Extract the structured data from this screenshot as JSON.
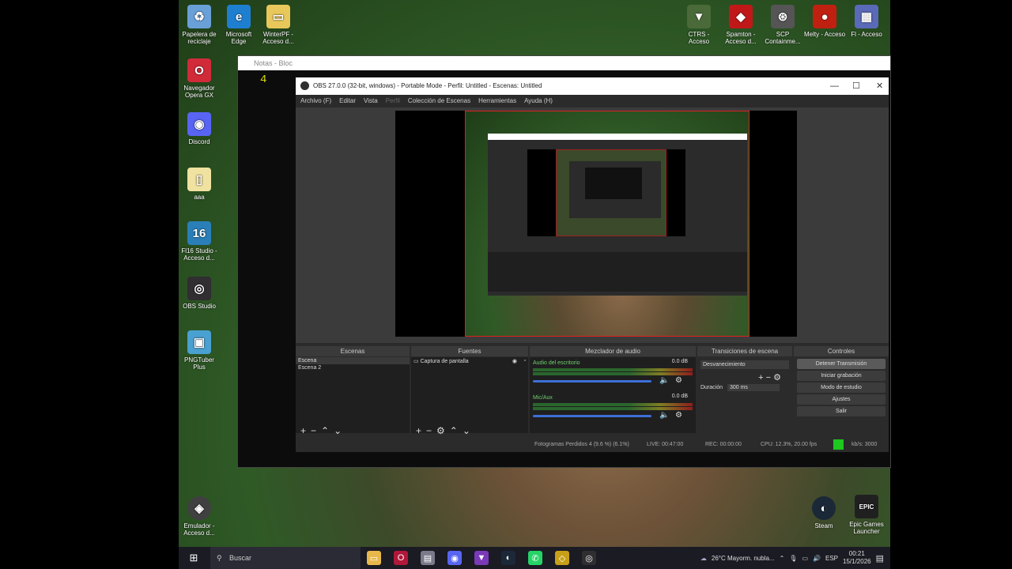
{
  "desktop": {
    "left_icons": [
      {
        "label": "Papelera de reciclaje",
        "icon": "recycle-bin-icon",
        "color": "#6aa0d8",
        "glyph": "♻"
      },
      {
        "label": "Microsoft Edge",
        "icon": "edge-icon",
        "color": "#1e7fd1",
        "glyph": "e"
      },
      {
        "label": "WinterPF - Acceso d...",
        "icon": "folder-icon",
        "color": "#e8c85a",
        "glyph": "▭"
      },
      {
        "label": "Navegador Opera GX",
        "icon": "opera-gx-icon",
        "color": "#d12b3a",
        "glyph": "O"
      },
      {
        "label": "Discord",
        "icon": "discord-icon",
        "color": "#5865f2",
        "glyph": "◉"
      },
      {
        "label": "aaa",
        "icon": "file-icon",
        "color": "#f0e2a0",
        "glyph": "▯"
      },
      {
        "label": "Fl16 Studio - Acceso d...",
        "icon": "fl-studio-icon",
        "color": "#2a7fb8",
        "glyph": "16"
      },
      {
        "label": "OBS Studio",
        "icon": "obs-icon",
        "color": "#302e31",
        "glyph": "◎"
      },
      {
        "label": "PNGTuber Plus",
        "icon": "pngtuber-icon",
        "color": "#4aa0d0",
        "glyph": "▣"
      }
    ],
    "right_icons": [
      {
        "label": "CTRS - Acceso",
        "icon": "ctrs-icon",
        "color": "#4a6a3a",
        "glyph": "▼"
      },
      {
        "label": "Spamton - Acceso d...",
        "icon": "spamton-icon",
        "color": "#c01818",
        "glyph": "◆"
      },
      {
        "label": "SCP Containme...",
        "icon": "scp-icon",
        "color": "#555555",
        "glyph": "⊛"
      },
      {
        "label": "Melty - Acceso",
        "icon": "melty-icon",
        "color": "#c02010",
        "glyph": "●"
      },
      {
        "label": "Fl - Acceso",
        "icon": "file-icon",
        "color": "#5a6ab8",
        "glyph": "▦"
      }
    ],
    "bottom_left_icon": {
      "label": "Emulador - Acceso d...",
      "icon": "emulator-icon",
      "color": "#404040",
      "glyph": "◈"
    },
    "bottom_right_icons": [
      {
        "label": "Steam",
        "icon": "steam-icon",
        "color": "#1b2838",
        "glyph": "◐"
      },
      {
        "label": "Epic Games Launcher",
        "icon": "epic-games-icon",
        "color": "#202020",
        "glyph": "EPIC"
      }
    ]
  },
  "console": {
    "title": "Notas - Bloc",
    "cursor": "4"
  },
  "obs": {
    "title": "OBS 27.0.0 (32-bit, windows) - Portable Mode - Perfil: Untitled - Escenas: Untitled",
    "menu": [
      "Archivo (F)",
      "Editar",
      "Vista",
      "Perfil",
      "Colección de Escenas",
      "Herramientas",
      "Ayuda (H)"
    ],
    "panels": {
      "scenes": {
        "header": "Escenas",
        "items": [
          "Escena",
          "Escena 2"
        ]
      },
      "sources": {
        "header": "Fuentes",
        "items": [
          "Captura de pantalla"
        ]
      },
      "mixer": {
        "header": "Mezclador de audio",
        "tracks": [
          {
            "name": "Audio del escritorio",
            "db": "0.0 dB"
          },
          {
            "name": "Mic/Aux",
            "db": "0.0 dB"
          }
        ]
      },
      "transitions": {
        "header": "Transiciones de escena",
        "selected": "Desvanecimiento",
        "duration_label": "Duración",
        "duration_value": "300 ms"
      },
      "controls": {
        "header": "Controles",
        "buttons": [
          "Detener Transmisión",
          "Iniciar grabación",
          "Modo de estudio",
          "Ajustes",
          "Salir"
        ]
      }
    },
    "status": {
      "dropped": "Fotogramas Perdidos 4 (9.6 %) (6.1%)",
      "live": "LIVE: 00:47:00",
      "rec": "REC: 00:00:00",
      "cpu": "CPU: 12.3%, 20.00 fps",
      "kbps": "kb/s: 3000"
    }
  },
  "taskbar": {
    "search_placeholder": "Buscar",
    "apps": [
      {
        "icon": "file-explorer-icon",
        "color": "#e8b84a",
        "glyph": "▭"
      },
      {
        "icon": "opera-gx-icon",
        "color": "#b0183a",
        "glyph": "O"
      },
      {
        "icon": "notes-icon",
        "color": "#7a7a8a",
        "glyph": "▤"
      },
      {
        "icon": "discord-icon",
        "color": "#5865f2",
        "glyph": "◉"
      },
      {
        "icon": "app-icon",
        "color": "#7a3ab8",
        "glyph": "▼"
      },
      {
        "icon": "steam-icon",
        "color": "#1b2838",
        "glyph": "◐"
      },
      {
        "icon": "whatsapp-icon",
        "color": "#25d366",
        "glyph": "✆"
      },
      {
        "icon": "unity-icon",
        "color": "#c8a018",
        "glyph": "◇"
      },
      {
        "icon": "obs-icon",
        "color": "#302e31",
        "glyph": "◎"
      }
    ],
    "weather": "26°C Mayorm. nubla...",
    "lang": "ESP",
    "time": "00:21",
    "date": "15/1/2026"
  }
}
